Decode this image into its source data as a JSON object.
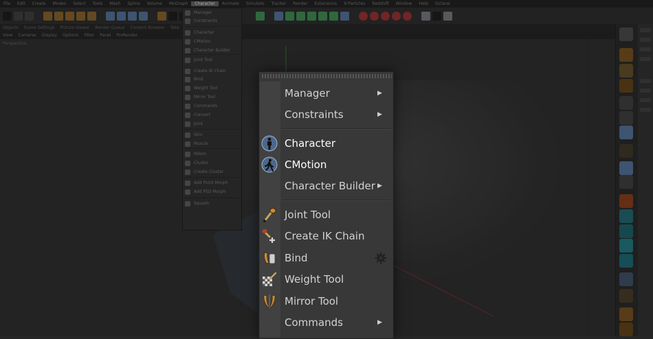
{
  "menubar": {
    "items": [
      "File",
      "Edit",
      "Create",
      "Modes",
      "Select",
      "Tools",
      "Mesh",
      "Spline",
      "Volume",
      "MoGraph",
      "Character",
      "Animate",
      "Simulate",
      "Tracker",
      "Render",
      "Extensions",
      "X-Particles",
      "Redshift",
      "Window",
      "Help",
      "Octane"
    ],
    "active_index": 10
  },
  "subbar": {
    "items": [
      "Objects",
      "Scene Settings",
      "Picture Viewer",
      "Render Queue",
      "Content Browser",
      "Take"
    ]
  },
  "viewbar": {
    "items": [
      "View",
      "Cameras",
      "Display",
      "Options",
      "Filter",
      "Panel",
      "ProRender"
    ],
    "viewport_label": "Perspective"
  },
  "bg_menu": {
    "items": [
      "Manager",
      "Constraints",
      "Character",
      "CMotion",
      "Character Builder",
      "Joint Tool",
      "Create IK Chain",
      "Bind",
      "Weight Tool",
      "Mirror Tool",
      "Commands",
      "Convert",
      "Joint",
      "Skin",
      "Muscle",
      "Mdsm",
      "Cluster",
      "Create Cluster",
      "Add Point Morph",
      "Add PSD Morph",
      "Squash"
    ]
  },
  "menu": {
    "items": [
      {
        "label": "Manager",
        "submenu": true
      },
      {
        "label": "Constraints",
        "submenu": true
      },
      {
        "label": "Character",
        "submenu": false,
        "icon": "character-figure-icon"
      },
      {
        "label": "CMotion",
        "submenu": false,
        "icon": "cmotion-walk-icon"
      },
      {
        "label": "Character Builder",
        "submenu": true
      },
      {
        "label": "Joint Tool",
        "submenu": false,
        "icon": "joint-tool-icon"
      },
      {
        "label": "Create IK Chain",
        "submenu": false,
        "icon": "ik-chain-icon"
      },
      {
        "label": "Bind",
        "submenu": false,
        "icon": "bind-icon",
        "has_options": true
      },
      {
        "label": "Weight Tool",
        "submenu": false,
        "icon": "weight-tool-icon"
      },
      {
        "label": "Mirror Tool",
        "submenu": false,
        "icon": "mirror-tool-icon"
      },
      {
        "label": "Commands",
        "submenu": true
      }
    ],
    "arrow_glyph": "▶"
  },
  "colors": {
    "accent_blue": "#4c6789",
    "menu_bg": "#383838",
    "text": "#d2d2d2"
  }
}
